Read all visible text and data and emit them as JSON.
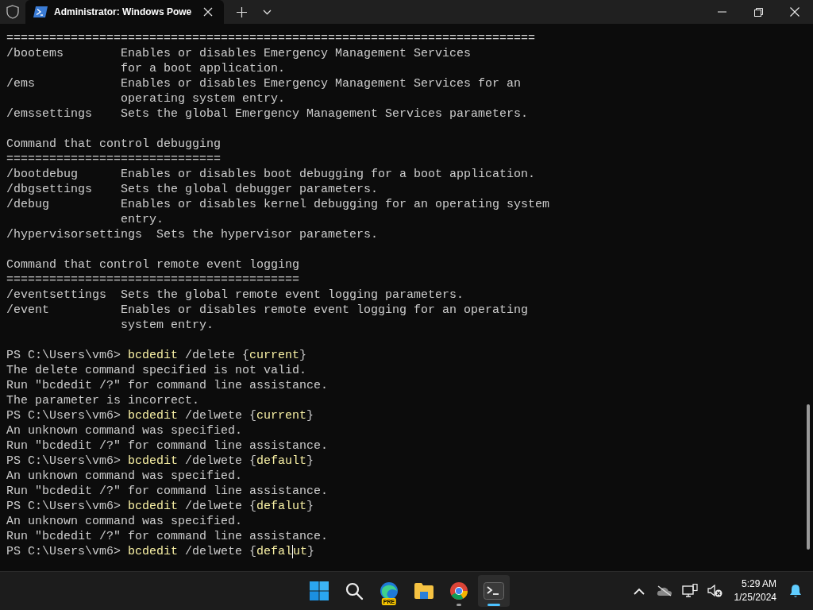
{
  "window": {
    "tab_title": "Administrator: Windows Powe"
  },
  "terminal": {
    "lines": [
      {
        "kind": "text",
        "text": "=========================================================================="
      },
      {
        "kind": "help",
        "option": "/bootems",
        "description": "Enables or disables Emergency Management Services"
      },
      {
        "kind": "help",
        "description": "for a boot application."
      },
      {
        "kind": "help",
        "option": "/ems",
        "description": "Enables or disables Emergency Management Services for an"
      },
      {
        "kind": "help",
        "description": "operating system entry."
      },
      {
        "kind": "help",
        "option": "/emssettings",
        "description": "Sets the global Emergency Management Services parameters."
      },
      {
        "kind": "blank"
      },
      {
        "kind": "text",
        "text": "Command that control debugging"
      },
      {
        "kind": "text",
        "text": "=============================="
      },
      {
        "kind": "help",
        "option": "/bootdebug",
        "description": "Enables or disables boot debugging for a boot application."
      },
      {
        "kind": "help",
        "option": "/dbgsettings",
        "description": "Sets the global debugger parameters."
      },
      {
        "kind": "help",
        "option": "/debug",
        "description": "Enables or disables kernel debugging for an operating system"
      },
      {
        "kind": "help",
        "description": "entry."
      },
      {
        "kind": "help",
        "option": "/hypervisorsettings",
        "description": "Sets the hypervisor parameters."
      },
      {
        "kind": "blank"
      },
      {
        "kind": "text",
        "text": "Command that control remote event logging"
      },
      {
        "kind": "text",
        "text": "========================================="
      },
      {
        "kind": "help",
        "option": "/eventsettings",
        "description": "Sets the global remote event logging parameters."
      },
      {
        "kind": "help",
        "option": "/event",
        "description": "Enables or disables remote event logging for an operating"
      },
      {
        "kind": "help",
        "description": "system entry."
      },
      {
        "kind": "blank"
      },
      {
        "kind": "prompt",
        "segments": [
          {
            "kind": "plain",
            "text": "PS C:\\Users\\vm6> "
          },
          {
            "kind": "command",
            "text": "bcdedit"
          },
          {
            "kind": "plain",
            "text": " /delete {"
          },
          {
            "kind": "command",
            "text": "current"
          },
          {
            "kind": "plain",
            "text": "}"
          }
        ]
      },
      {
        "kind": "text",
        "text": "The delete command specified is not valid."
      },
      {
        "kind": "text",
        "text": "Run \"bcdedit /?\" for command line assistance."
      },
      {
        "kind": "text",
        "text": "The parameter is incorrect."
      },
      {
        "kind": "prompt",
        "segments": [
          {
            "kind": "plain",
            "text": "PS C:\\Users\\vm6> "
          },
          {
            "kind": "command",
            "text": "bcdedit"
          },
          {
            "kind": "plain",
            "text": " /delwete {"
          },
          {
            "kind": "command",
            "text": "current"
          },
          {
            "kind": "plain",
            "text": "}"
          }
        ]
      },
      {
        "kind": "text",
        "text": "An unknown command was specified."
      },
      {
        "kind": "text",
        "text": "Run \"bcdedit /?\" for command line assistance."
      },
      {
        "kind": "prompt",
        "segments": [
          {
            "kind": "plain",
            "text": "PS C:\\Users\\vm6> "
          },
          {
            "kind": "command",
            "text": "bcdedit"
          },
          {
            "kind": "plain",
            "text": " /delwete {"
          },
          {
            "kind": "command",
            "text": "default"
          },
          {
            "kind": "plain",
            "text": "}"
          }
        ]
      },
      {
        "kind": "text",
        "text": "An unknown command was specified."
      },
      {
        "kind": "text",
        "text": "Run \"bcdedit /?\" for command line assistance."
      },
      {
        "kind": "prompt",
        "segments": [
          {
            "kind": "plain",
            "text": "PS C:\\Users\\vm6> "
          },
          {
            "kind": "command",
            "text": "bcdedit"
          },
          {
            "kind": "plain",
            "text": " /delwete {"
          },
          {
            "kind": "command",
            "text": "defalut"
          },
          {
            "kind": "plain",
            "text": "}"
          }
        ]
      },
      {
        "kind": "text",
        "text": "An unknown command was specified."
      },
      {
        "kind": "text",
        "text": "Run \"bcdedit /?\" for command line assistance."
      },
      {
        "kind": "prompt",
        "segments": [
          {
            "kind": "plain",
            "text": "PS C:\\Users\\vm6> "
          },
          {
            "kind": "command",
            "text": "bcdedit"
          },
          {
            "kind": "plain",
            "text": " /delwete {"
          },
          {
            "kind": "command",
            "text": "defal",
            "cursor": true
          },
          {
            "kind": "command",
            "text": "ut"
          },
          {
            "kind": "plain",
            "text": "}"
          }
        ]
      }
    ]
  },
  "taskbar": {
    "apps": [
      {
        "kind": "start",
        "selected": false,
        "running": false
      },
      {
        "kind": "search",
        "selected": false,
        "running": false
      },
      {
        "kind": "edge",
        "badge": "PRE",
        "selected": false,
        "running": false
      },
      {
        "kind": "files",
        "selected": false,
        "running": false
      },
      {
        "kind": "chrome",
        "selected": false,
        "running": true
      },
      {
        "kind": "terminal",
        "selected": true,
        "running": true
      }
    ],
    "tray": [
      {
        "kind": "chevron"
      },
      {
        "kind": "cloud"
      },
      {
        "kind": "network"
      },
      {
        "kind": "volume"
      }
    ],
    "time": "5:29 AM",
    "date": "1/25/2024"
  }
}
